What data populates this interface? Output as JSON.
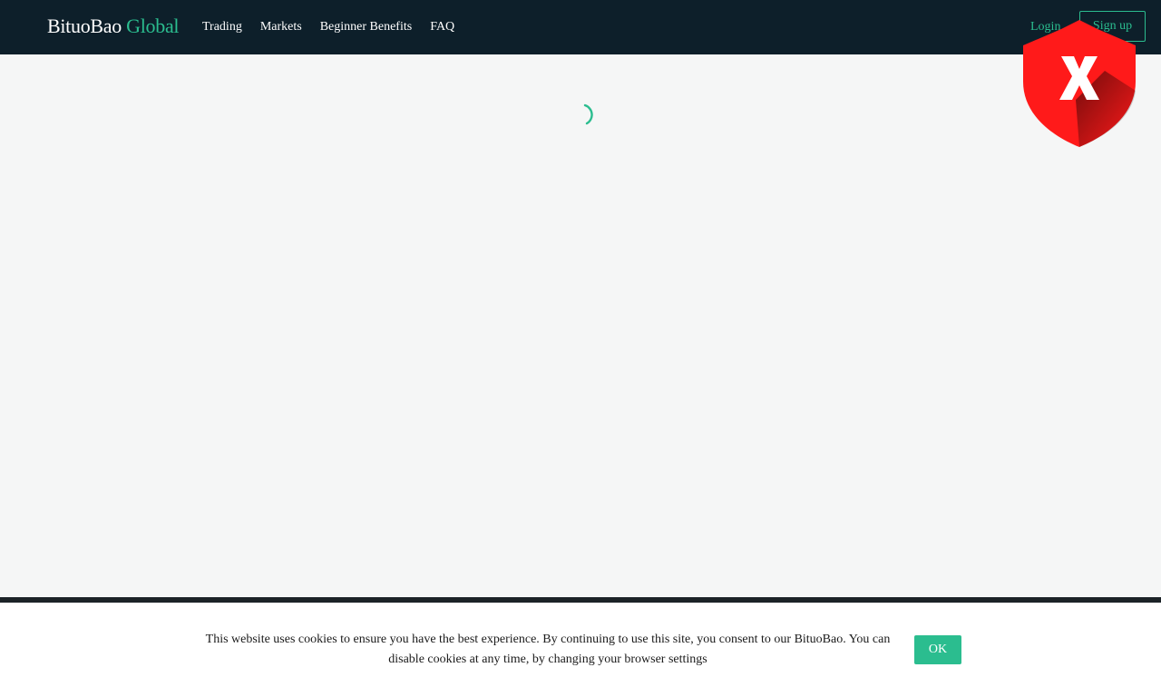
{
  "header": {
    "logo_main": "BituoBao",
    "logo_accent": "Global",
    "nav": [
      "Trading",
      "Markets",
      "Beginner Benefits",
      "FAQ"
    ],
    "login_label": "Login",
    "signup_label": "Sign up"
  },
  "overlay": {
    "icon": "shield-x-icon",
    "glyph": "X"
  },
  "main": {
    "spinner_icon": "loading-spinner-icon"
  },
  "cookie": {
    "text": "This website uses cookies to ensure you have the best experience. By continuing to use this site, you consent to our BituoBao. You can disable cookies at any time, by changing your browser settings",
    "ok_label": "OK"
  },
  "colors": {
    "header_bg": "#0d1f2a",
    "accent": "#2bbd8f",
    "page_bg": "#f5f6f6",
    "shield_red": "#ff1a1a"
  }
}
